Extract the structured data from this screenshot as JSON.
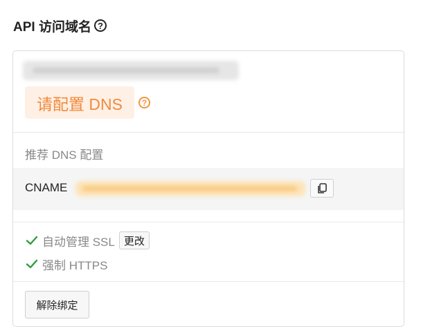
{
  "section": {
    "title": "API 访问域名",
    "help_icon": "?"
  },
  "card": {
    "dns_warning": "请配置 DNS",
    "dns_help_icon": "?",
    "recommended_title": "推荐 DNS 配置",
    "cname_label": "CNAME",
    "copy_icon": "copy-icon",
    "options": [
      {
        "label": "自动管理 SSL",
        "button": "更改"
      },
      {
        "label": "强制 HTTPS"
      }
    ],
    "unbind_button": "解除绑定"
  },
  "colors": {
    "accent": "#f28a3a",
    "warning_bg": "#fff0e6",
    "check": "#2e9c3f"
  }
}
